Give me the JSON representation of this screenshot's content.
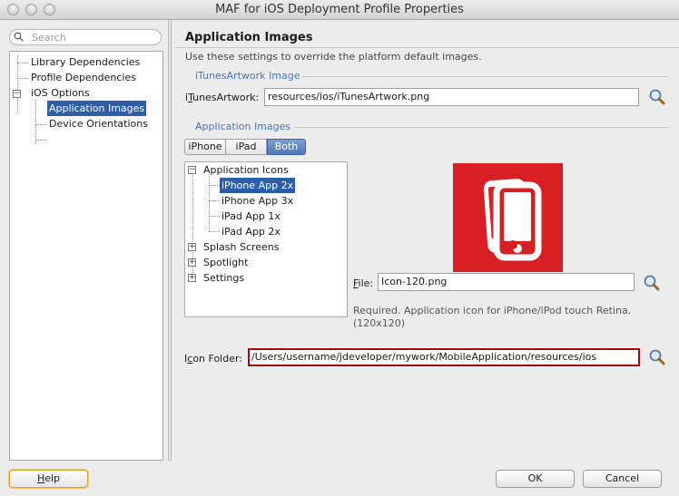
{
  "window": {
    "title": "MAF for iOS Deployment Profile Properties"
  },
  "sidebar": {
    "search_placeholder": "Search",
    "items": [
      {
        "label": "Library Dependencies"
      },
      {
        "label": "Profile Dependencies"
      },
      {
        "label": "iOS Options"
      },
      {
        "label": "Application Images",
        "selected": true
      },
      {
        "label": "Device Orientations"
      }
    ]
  },
  "page": {
    "title": "Application Images",
    "description": "Use these settings to override the platform default images.",
    "itunes_section": "iTunesArtwork Image",
    "itunes_label_pre": "i",
    "itunes_label_mnemonic": "T",
    "itunes_label_post": "unesArtwork:",
    "itunes_value": "resources/ios/iTunesArtwork.png",
    "images_section": "Application Images",
    "device_tabs": [
      {
        "label": "iPhone"
      },
      {
        "label": "iPad"
      },
      {
        "label": "Both",
        "selected": true
      }
    ],
    "tree": {
      "application_icons": "Application Icons",
      "children": [
        "iPhone App 2x",
        "iPhone App 3x",
        "iPad App 1x",
        "iPad App 2x"
      ],
      "selected_child": "iPhone App 2x",
      "splash_screens": "Splash Screens",
      "spotlight": "Spotlight",
      "settings": "Settings"
    },
    "file_label_mnemonic": "F",
    "file_label_rest": "ile:",
    "file_value": "Icon-120.png",
    "note_line1": "Required. Application icon for iPhone/iPod touch Retina.",
    "note_line2": "(120x120)",
    "folder_label_pre": "I",
    "folder_label_mnemonic": "c",
    "folder_label_post": "on Folder:",
    "folder_value": "/Users/username/jdeveloper/mywork/MobileApplication/resources/ios"
  },
  "footer": {
    "help_mnemonic": "H",
    "help_rest": "elp",
    "ok_label": "OK",
    "cancel_label": "Cancel"
  },
  "colors": {
    "accent": "#2c5fa8",
    "preview_bg": "#d81f23",
    "error_border": "#a30a0a",
    "section": "#4a74b5"
  },
  "icons": [
    "close-traffic-icon",
    "minimize-traffic-icon",
    "zoom-traffic-icon",
    "search-icon",
    "magnifier-browse-icon",
    "app-preview-icon"
  ]
}
